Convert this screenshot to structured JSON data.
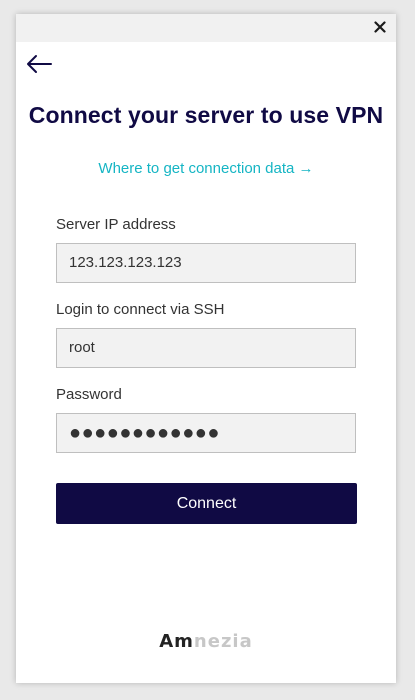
{
  "window": {
    "close_icon": "close-icon",
    "back_icon": "back-arrow-icon"
  },
  "title": "Connect your server to use VPN",
  "help_link": "Where to get connection data →",
  "fields": [
    {
      "label": "Server IP address",
      "value": "123.123.123.123"
    },
    {
      "label": "Login to connect via SSH",
      "value": "root"
    },
    {
      "label": "Password",
      "value": "●●●●●●●●●●●●"
    }
  ],
  "connect_button": "Connect",
  "logo": {
    "dark": "Am",
    "light": "nezia"
  },
  "colors": {
    "accent": "#100a44",
    "link": "#15b5c4",
    "input_bg": "#f2f2f2",
    "input_border": "#bfbfbf"
  }
}
